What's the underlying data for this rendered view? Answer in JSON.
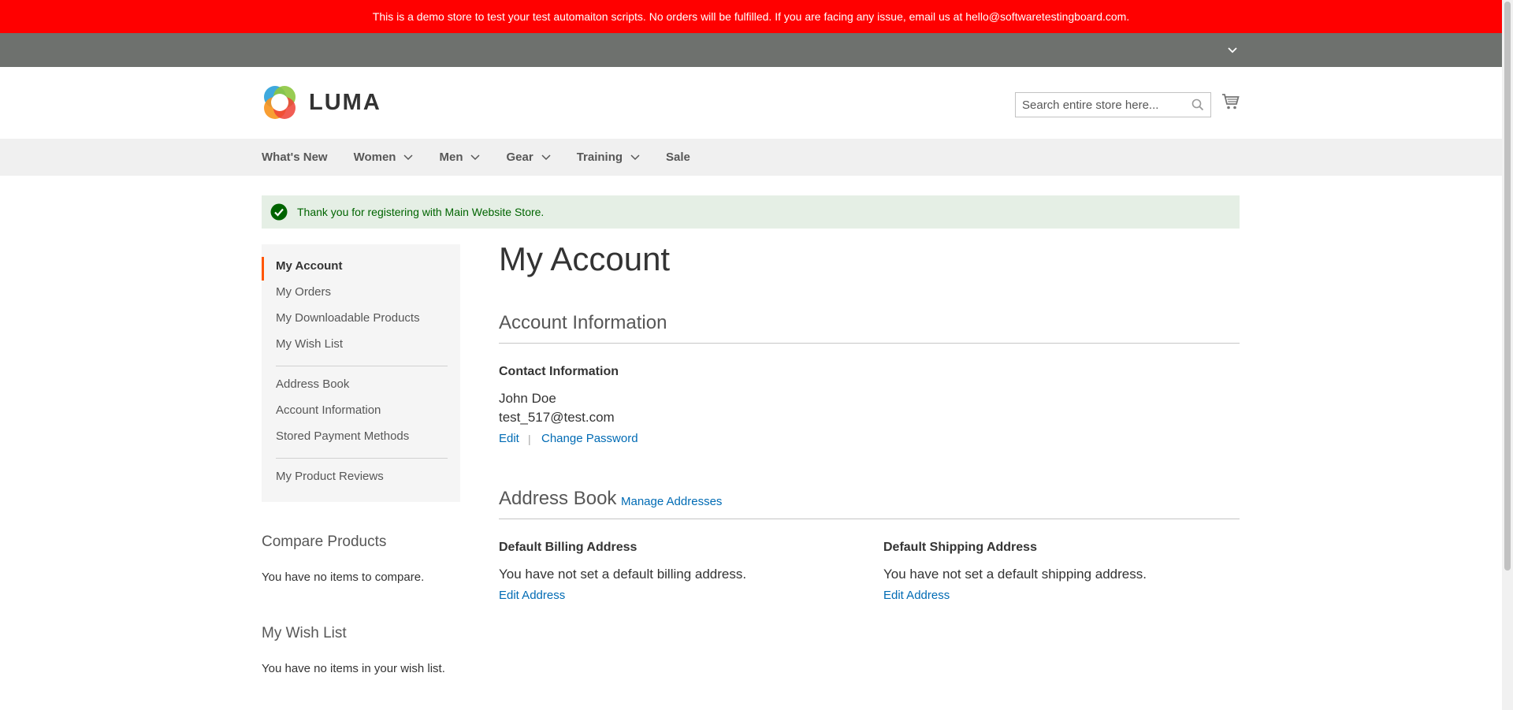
{
  "demo_banner": {
    "text": "This is a demo store to test your test automaiton scripts. No orders will be fulfilled. If you are facing any issue, email us at hello@softwaretestingboard.com."
  },
  "header": {
    "logo_text": "LUMA",
    "search_placeholder": "Search entire store here...",
    "search_value": ""
  },
  "nav": {
    "items": [
      {
        "label": "What's New"
      },
      {
        "label": "Women"
      },
      {
        "label": "Men"
      },
      {
        "label": "Gear"
      },
      {
        "label": "Training"
      },
      {
        "label": "Sale"
      }
    ]
  },
  "message": {
    "text": "Thank you for registering with Main Website Store."
  },
  "sidebar": {
    "items": [
      {
        "label": "My Account"
      },
      {
        "label": "My Orders"
      },
      {
        "label": "My Downloadable Products"
      },
      {
        "label": "My Wish List"
      },
      {
        "label": "Address Book"
      },
      {
        "label": "Account Information"
      },
      {
        "label": "Stored Payment Methods"
      },
      {
        "label": "My Product Reviews"
      }
    ],
    "compare_title": "Compare Products",
    "compare_text": "You have no items to compare.",
    "wishlist_title": "My Wish List",
    "wishlist_text": "You have no items in your wish list."
  },
  "main": {
    "page_title": "My Account",
    "account_info": {
      "title": "Account Information",
      "contact_title": "Contact Information",
      "name": "John Doe",
      "email": "test_517@test.com",
      "edit_label": "Edit",
      "separator": "|",
      "change_password_label": "Change Password"
    },
    "address_book": {
      "title": "Address Book",
      "manage_label": "Manage Addresses",
      "billing_title": "Default Billing Address",
      "billing_text": "You have not set a default billing address.",
      "billing_edit": "Edit Address",
      "shipping_title": "Default Shipping Address",
      "shipping_text": "You have not set a default shipping address.",
      "shipping_edit": "Edit Address"
    }
  },
  "icons": {
    "panel_toggle": "chevron-down-icon",
    "search": "search-icon",
    "cart": "cart-icon",
    "success": "check-circle-icon"
  },
  "colors": {
    "banner_bg": "#ff0000",
    "panel_bg": "#6e716e",
    "link": "#006bb4",
    "active_accent": "#ff5501",
    "success_bg": "#e5efe5",
    "success_text": "#006400"
  }
}
